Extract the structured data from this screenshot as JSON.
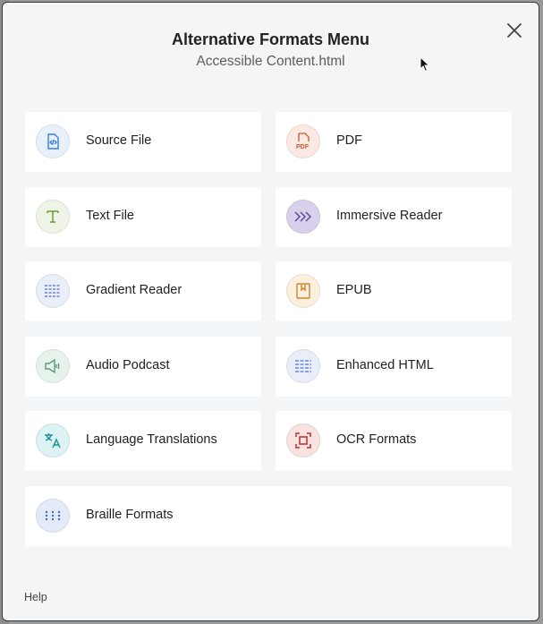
{
  "dialog": {
    "title": "Alternative Formats Menu",
    "subtitle": "Accessible Content.html"
  },
  "options": [
    {
      "label": "Source File",
      "icon": "code-file-icon",
      "accent": "#3b7dd8",
      "bg": "#e8f0fb"
    },
    {
      "label": "PDF",
      "icon": "pdf-file-icon",
      "accent": "#d2552e",
      "bg": "#fbe9e4"
    },
    {
      "label": "Text File",
      "icon": "text-file-icon",
      "accent": "#6b9a3a",
      "bg": "#eef4e6"
    },
    {
      "label": "Immersive Reader",
      "icon": "immersive-reader-icon",
      "accent": "#5c4a9e",
      "bg": "#d9d1ec"
    },
    {
      "label": "Gradient Reader",
      "icon": "gradient-reader-icon",
      "accent": "#4d72c8",
      "bg": "#e9eef9"
    },
    {
      "label": "EPUB",
      "icon": "book-icon",
      "accent": "#c9862e",
      "bg": "#fbefdd"
    },
    {
      "label": "Audio Podcast",
      "icon": "speaker-icon",
      "accent": "#5a9a7a",
      "bg": "#e6f3ec"
    },
    {
      "label": "Enhanced HTML",
      "icon": "enhanced-html-icon",
      "accent": "#4d72c8",
      "bg": "#e9eef9"
    },
    {
      "label": "Language Translations",
      "icon": "translate-icon",
      "accent": "#1b8f94",
      "bg": "#dcf2f3"
    },
    {
      "label": "OCR Formats",
      "icon": "ocr-scan-icon",
      "accent": "#b8332f",
      "bg": "#f9e2e1"
    },
    {
      "label": "Braille Formats",
      "icon": "braille-icon",
      "accent": "#3c6fc6",
      "bg": "#e3ebf9"
    }
  ],
  "footer": {
    "help_label": "Help"
  }
}
